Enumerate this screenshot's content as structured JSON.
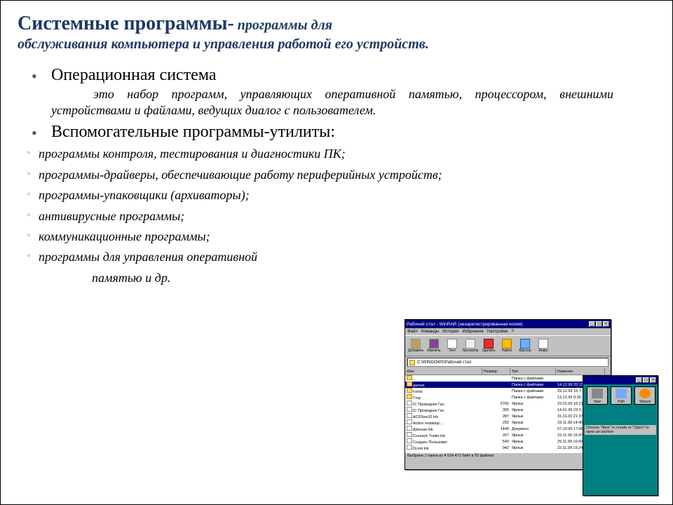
{
  "title": {
    "main": "Системные программы-",
    "tail": " программы для"
  },
  "subtitle": "обслуживания компьютера и управления работой его устройств.",
  "items": [
    {
      "heading": "Операционная система",
      "desc_prefix": "это набор программ, управляющих оперативной памятью, процессором,",
      "desc_rest": "внешними устройствами и файлами, ведущих диалог с пользователем."
    },
    {
      "heading": "Вспомогательные программы-утилиты:",
      "subs": [
        "программы контроля, тестирования и диагностики ПК;",
        "программы-драйверы, обеспечивающие работу периферийных устройств;",
        "программы-упаковщики (архиваторы);",
        "антивирусные программы;",
        "коммуникационные программы;",
        "программы для управления оперативной"
      ],
      "tail": "памятью и др."
    }
  ],
  "win1": {
    "title": "Рабочий стол - WinRAR (незарегистрированная копия)",
    "menus": [
      "Файл",
      "Команды",
      "История",
      "Избранное",
      "Настройки",
      "?"
    ],
    "tools": [
      "Добавить",
      "Извлечь",
      "Тест",
      "Просмотр",
      "Удалить",
      "Найти",
      "Мастер",
      "Инфо"
    ],
    "path": "C:\\WINDOWS\\Рабочий стол",
    "cols": [
      "Имя",
      "Размер",
      "Тип",
      "Изменён"
    ],
    "rows": [
      {
        "name": "..",
        "size": "",
        "type": "Папка с файлами",
        "date": "",
        "icon": "folder"
      },
      {
        "name": "games",
        "size": "",
        "type": "Папка с файлами",
        "date": "14.12.99 20:13",
        "icon": "folder",
        "sel": true
      },
      {
        "name": "Fonts",
        "size": "",
        "type": "Папка с файлами",
        "date": "29.12.99 15:7",
        "icon": "folder"
      },
      {
        "name": "Tmp",
        "size": "",
        "type": "Папка с файлами",
        "date": "13.12.99 9:35",
        "icon": "folder"
      },
      {
        "name": "IC Проводник Гис.",
        "size": "5760",
        "type": "Ярлык",
        "date": "23.01.00 16:21",
        "icon": "file"
      },
      {
        "name": "IC Проводник Гис.",
        "size": "355",
        "type": "Ярлык",
        "date": "14.01.99 23:1",
        "icon": "file"
      },
      {
        "name": "ACDSee32.lnk",
        "size": "287",
        "type": "Ярлык",
        "date": "31.01.00 21:37",
        "icon": "file"
      },
      {
        "name": "Action redaktop…",
        "size": "252",
        "type": "Ярлык",
        "date": "23.11.99 14:40",
        "icon": "file"
      },
      {
        "name": "Adresse.lnk",
        "size": "1449",
        "type": "Документ",
        "date": "07.10.99 17:45",
        "icon": "file"
      },
      {
        "name": "Cossack Trailer.lnk",
        "size": "267",
        "type": "Ярлык",
        "date": "23.11.99 15:47",
        "icon": "file"
      },
      {
        "name": "Создать Пользоват",
        "size": "540",
        "type": "Ярлык",
        "date": "29.11.99 10:42",
        "icon": "file"
      },
      {
        "name": "Dcom.lnk",
        "size": "942",
        "type": "Ярлык",
        "date": "22.11.99 15:24",
        "icon": "file"
      }
    ],
    "status": "Выбрано 1 папка из 4 524 471 байт в 50 файлах"
  },
  "win2": {
    "thumbs": [
      "New",
      "Path",
      "Wizard"
    ],
    "caption": "Choose \"New\" to create or \"Open\" to open an archive"
  }
}
